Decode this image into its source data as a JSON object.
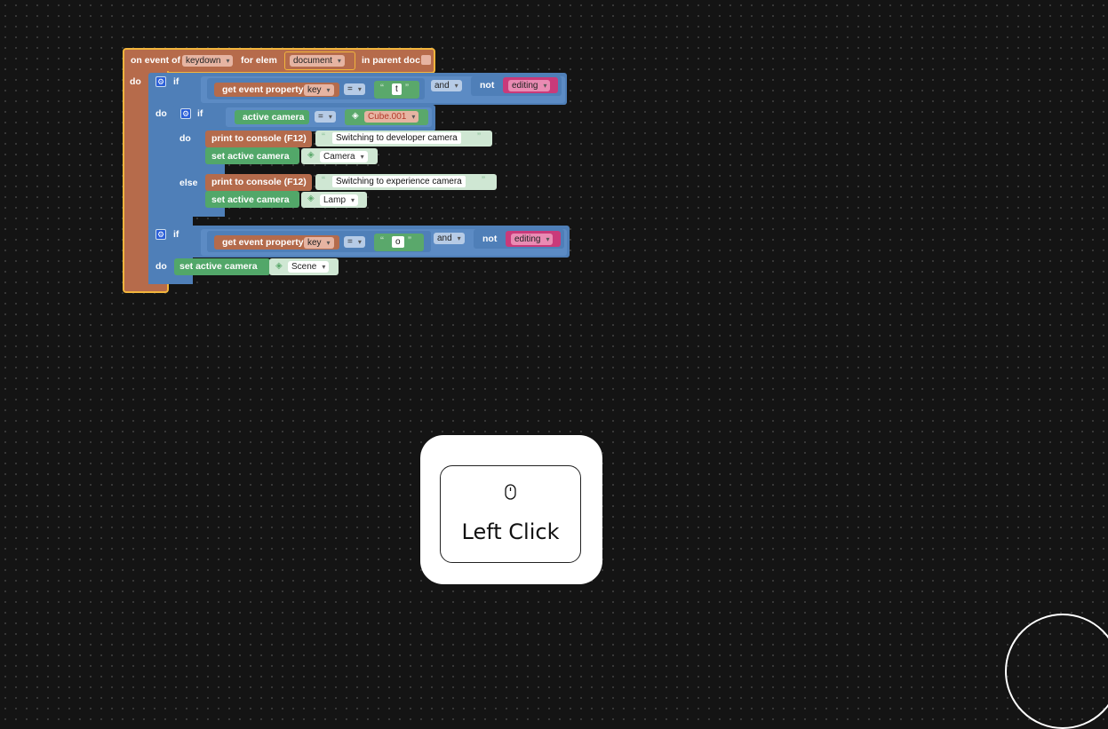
{
  "event_block": {
    "label_on_event": "on event of",
    "event_value": "keydown",
    "label_for_elem": "for elem",
    "elem_value": "document",
    "label_in_parent": "in parent doc",
    "label_do": "do"
  },
  "if1": {
    "label_if": "if",
    "get_prop_label": "get event property",
    "prop_value": "key",
    "op": "=",
    "str_value": "t",
    "and_label": "and",
    "not_label": "not",
    "editing_value": "editing",
    "label_do": "do"
  },
  "if_nested": {
    "label_if": "if",
    "active_camera_label": "active camera",
    "op": "=",
    "camera_value": "Cube.001",
    "label_do": "do",
    "label_else": "else",
    "print1_label": "print to console (F12)",
    "print1_text": "Switching to developer camera",
    "set1_label": "set active camera",
    "set1_value": "Camera",
    "print2_label": "print to console (F12)",
    "print2_text": "Switching to experience camera",
    "set2_label": "set active camera",
    "set2_value": "Lamp"
  },
  "if2": {
    "label_if": "if",
    "get_prop_label": "get event property",
    "prop_value": "key",
    "op": "=",
    "str_value": "o",
    "and_label": "and",
    "not_label": "not",
    "editing_value": "editing",
    "label_do": "do",
    "set_label": "set active camera",
    "set_value": "Scene"
  },
  "popup": {
    "icon": "mouse-icon",
    "label": "Left Click"
  },
  "colors": {
    "event": "#b66b4b",
    "event_border": "#f2b53c",
    "logic": "#4f7fb8",
    "action": "#52a769"
  }
}
